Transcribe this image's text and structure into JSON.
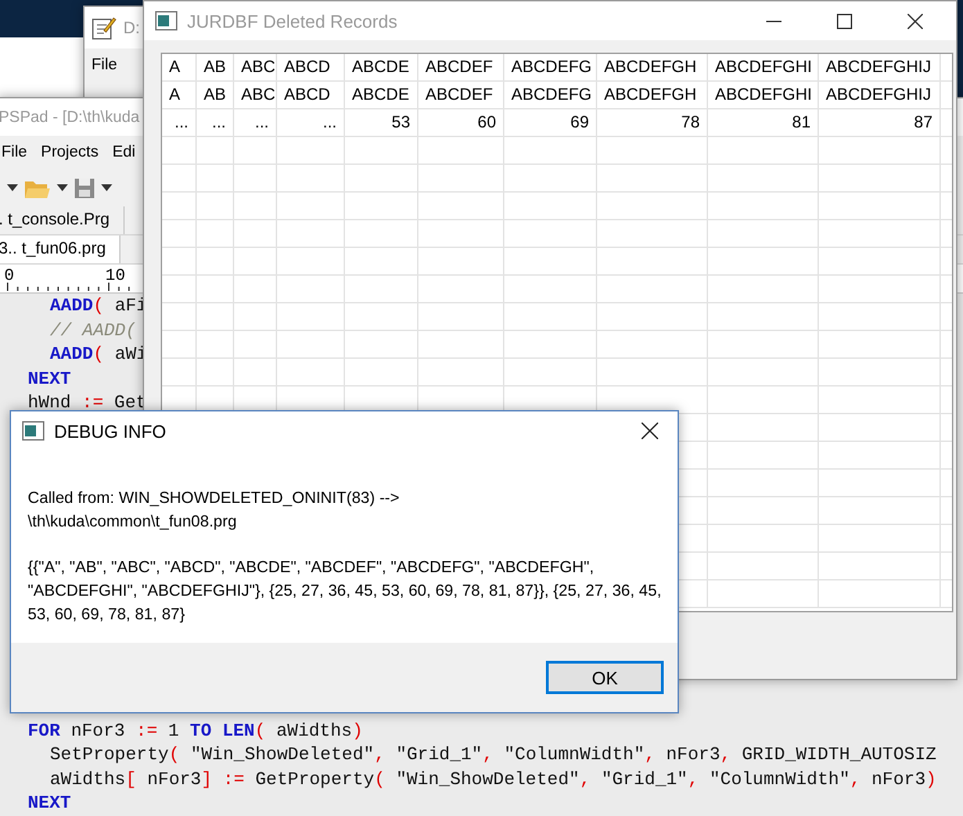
{
  "background_window": {
    "title": "D:",
    "menu": [
      "File"
    ]
  },
  "editor": {
    "title": "PSPad - [D:\\th\\kuda",
    "menu": [
      "File",
      "Projects",
      "Edi"
    ],
    "tabs": [
      {
        "label": ". t_console.Prg",
        "selected": false
      },
      {
        "label": "3.. t_fun06.prg",
        "selected": true
      }
    ],
    "ruler": [
      "0",
      "10"
    ],
    "code_top": [
      {
        "indented": true,
        "tokens": [
          {
            "kind": "keyword",
            "text": "AADD"
          },
          {
            "kind": "operator",
            "text": "("
          },
          {
            "kind": "plain",
            "text": " aFi"
          }
        ]
      },
      {
        "indented": true,
        "tokens": [
          {
            "kind": "comment",
            "text": "// AADD("
          }
        ]
      },
      {
        "indented": true,
        "tokens": [
          {
            "kind": "keyword",
            "text": "AADD"
          },
          {
            "kind": "operator",
            "text": "("
          },
          {
            "kind": "plain",
            "text": " aWi"
          }
        ]
      },
      {
        "indented": false,
        "tokens": [
          {
            "kind": "keyword",
            "text": "NEXT"
          }
        ]
      },
      {
        "indented": false,
        "tokens": [
          {
            "kind": "plain",
            "text": "hWnd "
          },
          {
            "kind": "operator",
            "text": ":="
          },
          {
            "kind": "plain",
            "text": " Get"
          }
        ]
      }
    ],
    "code_bottom": [
      {
        "indented": false,
        "tokens": [
          {
            "kind": "keyword",
            "text": "FOR"
          },
          {
            "kind": "plain",
            "text": " nFor3 "
          },
          {
            "kind": "operator",
            "text": ":="
          },
          {
            "kind": "plain",
            "text": " 1 "
          },
          {
            "kind": "keyword",
            "text": "TO"
          },
          {
            "kind": "keyword",
            "text": " LEN"
          },
          {
            "kind": "operator",
            "text": "("
          },
          {
            "kind": "plain",
            "text": " aWidths"
          },
          {
            "kind": "operator",
            "text": ")"
          }
        ]
      },
      {
        "indented": true,
        "tokens": [
          {
            "kind": "plain",
            "text": "SetProperty"
          },
          {
            "kind": "operator",
            "text": "("
          },
          {
            "kind": "plain",
            "text": " \"Win_ShowDeleted\""
          },
          {
            "kind": "operator",
            "text": ","
          },
          {
            "kind": "plain",
            "text": " \"Grid_1\""
          },
          {
            "kind": "operator",
            "text": ","
          },
          {
            "kind": "plain",
            "text": " \"ColumnWidth\""
          },
          {
            "kind": "operator",
            "text": ","
          },
          {
            "kind": "plain",
            "text": " nFor3"
          },
          {
            "kind": "operator",
            "text": ","
          },
          {
            "kind": "plain",
            "text": " GRID_WIDTH_AUTOSIZ"
          }
        ]
      },
      {
        "indented": true,
        "tokens": [
          {
            "kind": "plain",
            "text": "aWidths"
          },
          {
            "kind": "operator",
            "text": "["
          },
          {
            "kind": "plain",
            "text": " nFor3"
          },
          {
            "kind": "operator",
            "text": "]"
          },
          {
            "kind": "operator",
            "text": " :="
          },
          {
            "kind": "plain",
            "text": " GetProperty"
          },
          {
            "kind": "operator",
            "text": "("
          },
          {
            "kind": "plain",
            "text": " \"Win_ShowDeleted\""
          },
          {
            "kind": "operator",
            "text": ","
          },
          {
            "kind": "plain",
            "text": " \"Grid_1\""
          },
          {
            "kind": "operator",
            "text": ","
          },
          {
            "kind": "plain",
            "text": " \"ColumnWidth\""
          },
          {
            "kind": "operator",
            "text": ","
          },
          {
            "kind": "plain",
            "text": " nFor3"
          },
          {
            "kind": "operator",
            "text": ")"
          }
        ]
      },
      {
        "indented": false,
        "tokens": [
          {
            "kind": "keyword",
            "text": "NEXT"
          }
        ]
      }
    ]
  },
  "records_window": {
    "title": "JURDBF Deleted Records",
    "rows": [
      [
        "A",
        "AB",
        "ABC",
        "ABCD",
        "ABCDE",
        "ABCDEF",
        "ABCDEFG",
        "ABCDEFGH",
        "ABCDEFGHI",
        "ABCDEFGHIJ"
      ],
      [
        "A",
        "AB",
        "ABC",
        "ABCD",
        "ABCDE",
        "ABCDEF",
        "ABCDEFG",
        "ABCDEFGH",
        "ABCDEFGHI",
        "ABCDEFGHIJ"
      ],
      [
        "...",
        "...",
        "...",
        "...",
        "53",
        "60",
        "69",
        "78",
        "81",
        "87"
      ]
    ]
  },
  "dialog": {
    "title": "DEBUG INFO",
    "paragraphs": [
      "Called from: WIN_SHOWDELETED_ONINIT(83) -->\n\\th\\kuda\\common\\t_fun08.prg",
      "{{\"A\", \"AB\", \"ABC\", \"ABCD\", \"ABCDE\", \"ABCDEF\", \"ABCDEFG\", \"ABCDEFGH\", \"ABCDEFGHI\", \"ABCDEFGHIJ\"}, {25, 27, 36, 45, 53, 60, 69, 78, 81, 87}}, {25, 27, 36, 45, 53, 60, 69, 78, 81, 87}"
    ],
    "button": "OK"
  }
}
